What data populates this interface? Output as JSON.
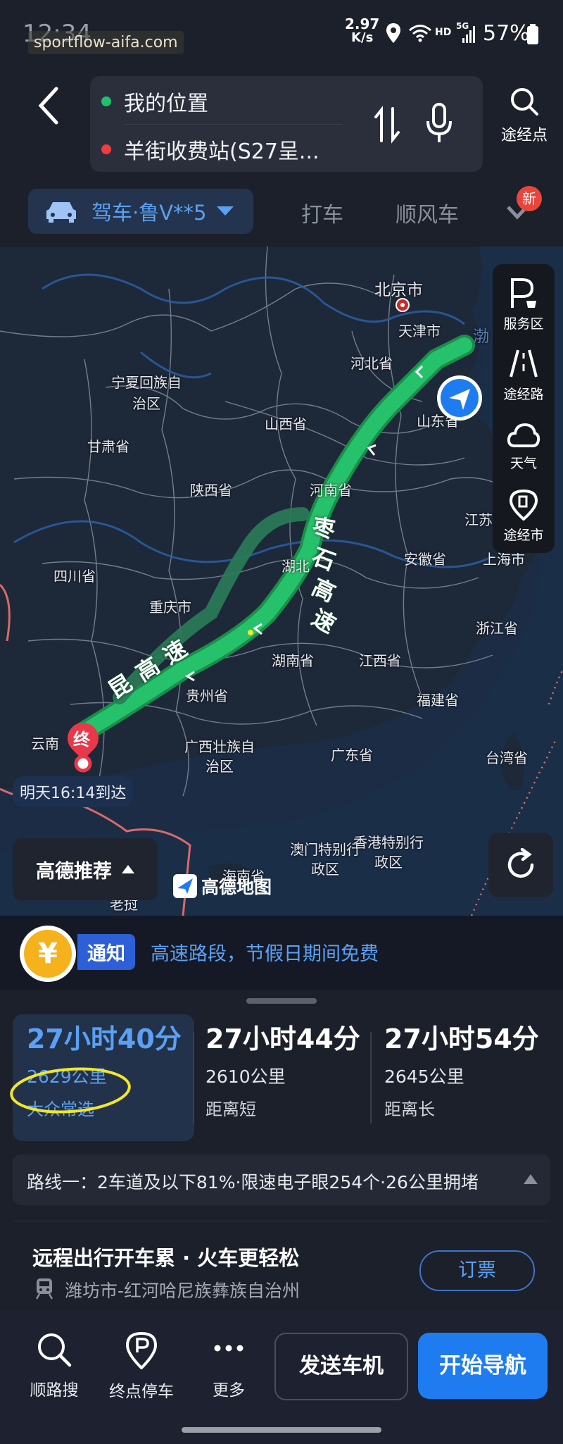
{
  "status_bar": {
    "time": "12:34",
    "watermark": "sportflow-aifa.com",
    "net_speed_value": "2.97",
    "net_speed_unit": "K/s",
    "signal": "5G",
    "hd": "HD",
    "battery": "57%"
  },
  "search": {
    "origin": "我的位置",
    "destination": "羊街收费站(S27呈...",
    "waypoints_label": "途经点"
  },
  "modes": {
    "active": "驾车·鲁V**5",
    "taxi": "打车",
    "carpool": "顺风车",
    "new_badge": "新"
  },
  "map": {
    "labels": {
      "beijing": "北京市",
      "tianjin": "天津市",
      "hebei": "河北省",
      "shanxi": "山西省",
      "shandong": "山东省",
      "ningxia": "宁夏回族自\n治区",
      "gansu": "甘肃省",
      "shaanxi": "陕西省",
      "henan": "河南省",
      "jiangsu": "江苏",
      "anhui": "安徽省",
      "shanghai": "上海市",
      "sichuan": "四川省",
      "chongqing": "重庆市",
      "hubei": "湖北",
      "zhejiang": "浙江省",
      "hunan": "湖南省",
      "jiangxi": "江西省",
      "guizhou": "贵州省",
      "fujian": "福建省",
      "yunnan": "云南",
      "guangxi": "广西壮族自\n治区",
      "guangdong": "广东省",
      "taiwan": "台湾省",
      "macau": "澳门特别行\n政区",
      "hongkong": "香港特别行\n政区",
      "hainan": "海南省",
      "laos": "老挝",
      "bohai": "渤"
    },
    "road_label_1": [
      "枣",
      "石",
      "高",
      "速"
    ],
    "road_label_2": [
      "昆",
      "高",
      "速"
    ],
    "end_marker": "终",
    "arrival": "明天16:14到达",
    "recommend": "高德推荐",
    "brand": "高德地图",
    "side_panel": [
      {
        "label": "服务区",
        "icon": "service-area-icon"
      },
      {
        "label": "途经路",
        "icon": "road-icon"
      },
      {
        "label": "天气",
        "icon": "cloud-icon"
      },
      {
        "label": "途经市",
        "icon": "city-icon"
      }
    ]
  },
  "notice": {
    "coin": "¥",
    "tag": "通知",
    "text": "高速路段，节假日期间免费"
  },
  "routes": {
    "options": [
      {
        "time": "27小时40分",
        "distance": "2629公里",
        "tag": "大众常选"
      },
      {
        "time": "27小时44分",
        "distance": "2610公里",
        "tag": "距离短"
      },
      {
        "time": "27小时54分",
        "distance": "2645公里",
        "tag": "距离长"
      }
    ],
    "detail": "路线一：2车道及以下81%·限速电子眼254个·26公里拥堵",
    "train_title": "远程出行开车累 · 火车更轻松",
    "train_route": "潍坊市-红河哈尼族彝族自治州",
    "ticket_button": "订票"
  },
  "bottom": {
    "search_along": "顺路搜",
    "parking": "终点停车",
    "more": "更多",
    "send_car": "发送车机",
    "start_nav": "开始导航"
  },
  "colors": {
    "accent": "#1f7cf0",
    "route_green": "#26c26b",
    "highlight_yellow": "#f3e628"
  }
}
